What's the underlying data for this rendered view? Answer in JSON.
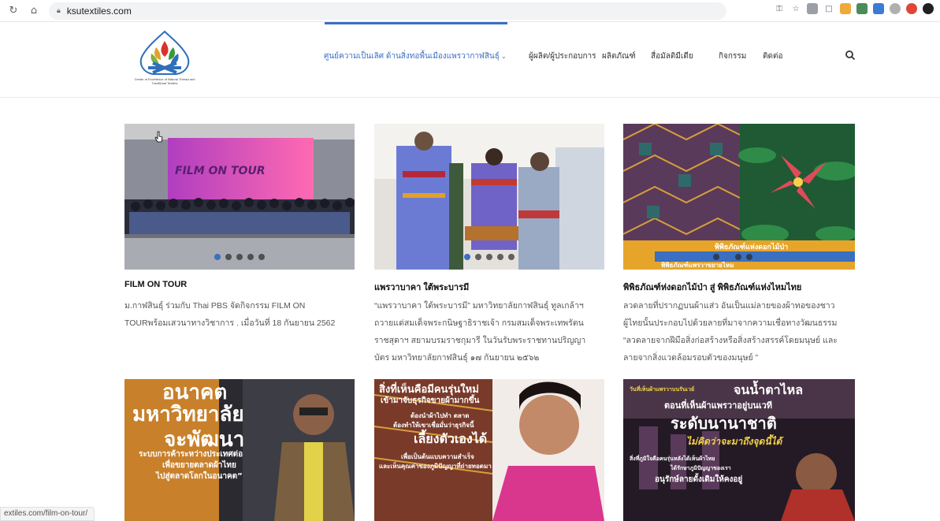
{
  "browser": {
    "url": "ksutextiles.com",
    "status_url": "extiles.com/film-on-tour/"
  },
  "site": {
    "logo_text": "Center of Excellence of Natural Thread and Traditional Textiles",
    "nav": [
      {
        "label": "ศูนย์ความเป็นเลิศ ด้านสิ่งทอพื้นเมืองแพรวากาฬสินธุ์",
        "active": true
      },
      {
        "label": "ผู้ผลิต/ผู้ประกอบการ"
      },
      {
        "label": "ผลิตภัณฑ์"
      },
      {
        "label": "สื่อมัลติมีเดีย"
      },
      {
        "label": "กิจกรรม"
      },
      {
        "label": "ติดต่อ"
      }
    ]
  },
  "cards": [
    {
      "title": "FILM ON TOUR",
      "body": [
        "ม.กาฬสินธุ์ ร่วมกับ Thai PBS จัดกิจกรรม FILM ON",
        "TOURพร้อมเสวนาทางวิชาการ . เมื่อวันที่ 18 กันยายน 2562"
      ],
      "image_text": "FILM ON TOUR",
      "active_dot": 0
    },
    {
      "title": "แพรวาบาคา ใต้พระบารมี",
      "body": [
        "“แพรวาบาคา ใต้พระบารมี” มหาวิทยาลัยกาฬสินธุ์ ทูลเกล้าฯ",
        "ถวายแด่สมเด็จพระกนิษฐาธิราชเจ้า กรมสมเด็จพระเทพรัตน",
        "ราชสุดาฯ สยามบรมราชกุมารี ในวันรับพระราชทานปริญญา",
        "บัตร มหาวิทยาลัยกาฬสินธุ์ ๑๗ กันยายน ๒๕๖๒"
      ],
      "active_dot": 0
    },
    {
      "title": "พิพิธภัณฑ์ห่งดอกไม้ป่า สู่ พิพิธภัณฑ์แห่งไหมไทย",
      "body": [
        "ลวดลายที่ปรากฏบนผ้าแส่ว อันเป็นแม่ลายของผ้าทอของชาว",
        "ผู้ไทยนั้นประกอบไปด้วยลายที่มาจากความเชื่อทางวัฒนธรรม",
        "“ลวดลายจากฝีมือสิ่งก่อสร้างหรือสิ่งสร้างสรรค์โดยมนุษย์ และ",
        "ลายจากสิ่งแวดล้อมรอบตัวของมนุษย์ ”"
      ],
      "image_text_1": "พิพิธภัณฑ์แห่งดอกไม้ป่า",
      "image_text_2": "พิพิธภัณฑ์แพรวาขยายไหม",
      "active_dot": 1
    }
  ],
  "row2": [
    {
      "lines": [
        "อนาคต",
        "มหาวิทยาลัย",
        "จะพัฒนา",
        "ระบบการค้าระหว่างประเทศต่อ",
        "เพื่อขยายตลาดผ้าไทย",
        "ไปสู่ตลาดโลกในอนาคต”"
      ]
    },
    {
      "lines": [
        "สิ่งที่เห็นคือมีคนรุ่นใหม่",
        "เข้ามาจับธุรกิจขายผ้ามากขึ้น",
        "ต้องนำผ้าไปทำ ตลาด",
        "ต้องทำให้เขาเชื่อมั่นว่าธุรกิจนี้",
        "เลี้ยงตัวเองได้",
        "เพื่อเป็นต้นแบบความสำเร็จ",
        "และเห็นคุณค่าของภูมิปัญญาที่ถ่ายทอดมา"
      ]
    },
    {
      "lines": [
        "วันที่เห็นผ้าแพรวาบนรันเวย์",
        "จนน้ำตาไหล",
        "ตอนที่เห็นผ้าแพรวาอยู่บนเวที",
        "ระดับนานาชาติ",
        "ไม่คิดว่าจะมาถึงจุดนี้ได้",
        "สิ่งที่ภูมิใจคือคนรุ่นหลังได้เห็นผ้าไทย",
        "ได้รักษาภูมิปัญญาของเรา",
        "อนุรักษ์ลายดั้งเดิมให้คงอยู่"
      ]
    }
  ],
  "colors": {
    "accent": "#3b6fc1",
    "banner_yellow": "#e6a52a"
  }
}
